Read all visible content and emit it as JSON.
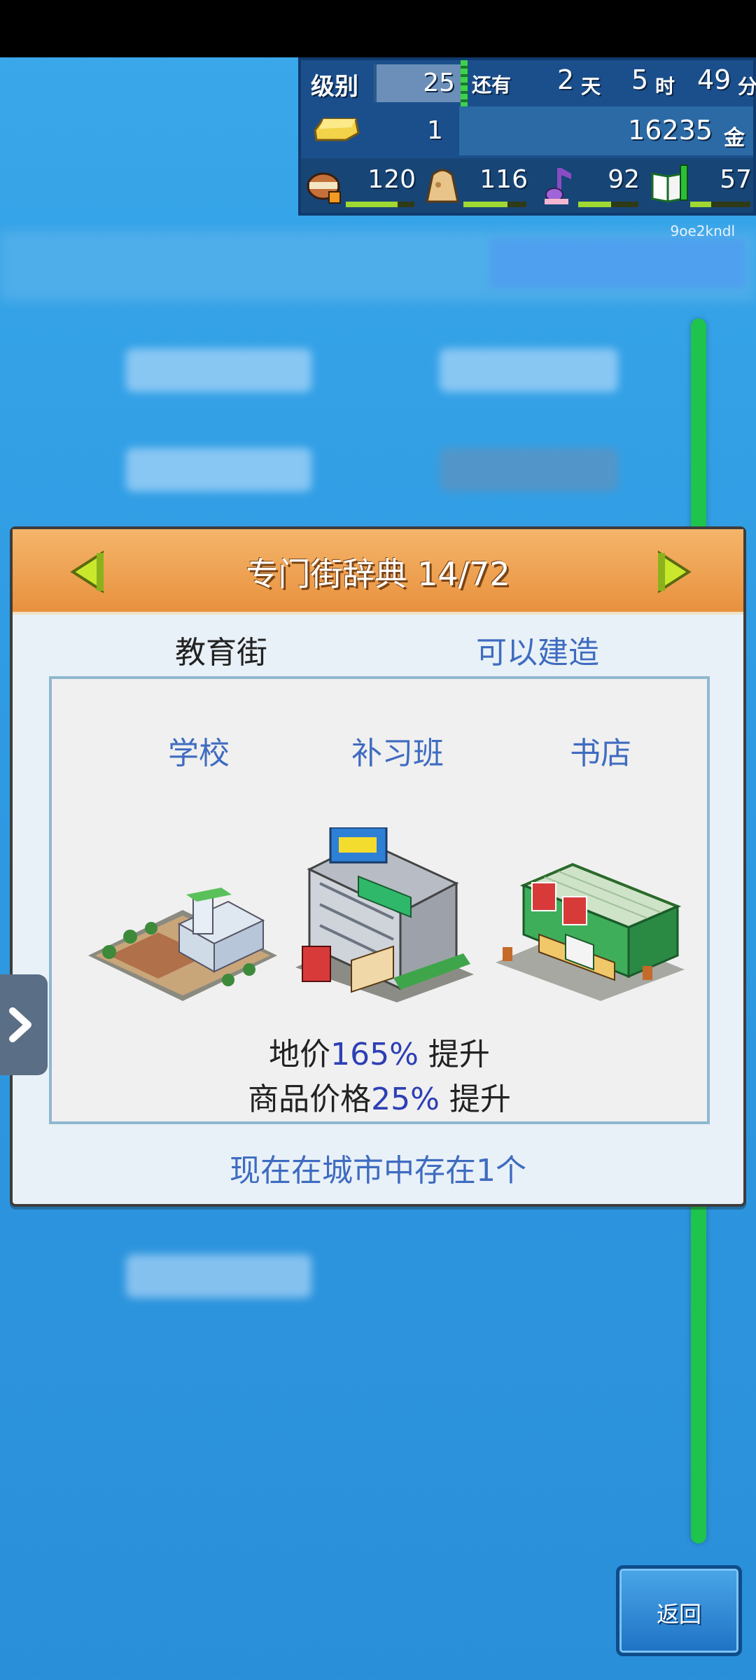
{
  "hud": {
    "level_label": "级别",
    "level_value": "25",
    "remaining_label": "还有",
    "days_value": "2",
    "days_unit": "天",
    "hours_value": "5",
    "hours_unit": "时",
    "minutes_value": "49",
    "minutes_unit": "分",
    "gold_bar_count": "1",
    "money": "16235",
    "money_unit": "金",
    "stats": [
      {
        "icon": "food-icon",
        "value": "120",
        "fill": 0.75
      },
      {
        "icon": "bag-icon",
        "value": "116",
        "fill": 0.7
      },
      {
        "icon": "music-note-icon",
        "value": "92",
        "fill": 0.55
      },
      {
        "icon": "book-icon",
        "value": "57",
        "fill": 0.35
      }
    ]
  },
  "watermark": "9oe2kndl",
  "dialog": {
    "title": "专门街辞典 14/72",
    "category": "教育街",
    "status": "可以建造",
    "buildings": [
      {
        "name": "学校",
        "icon": "school-building-icon"
      },
      {
        "name": "补习班",
        "icon": "cram-school-building-icon"
      },
      {
        "name": "书店",
        "icon": "bookstore-building-icon"
      }
    ],
    "effect1_prefix": "地价",
    "effect1_pct": "165%",
    "effect1_suffix": " 提升",
    "effect2_prefix": "商品价格",
    "effect2_pct": "25%",
    "effect2_suffix": " 提升",
    "footer": "现在在城市中存在1个"
  },
  "back_button": "返回",
  "colors": {
    "header_orange": "#e8913e",
    "link_blue": "#3f6cc0",
    "percent_blue": "#2d3fb4",
    "progress_green": "#1fc44d"
  }
}
